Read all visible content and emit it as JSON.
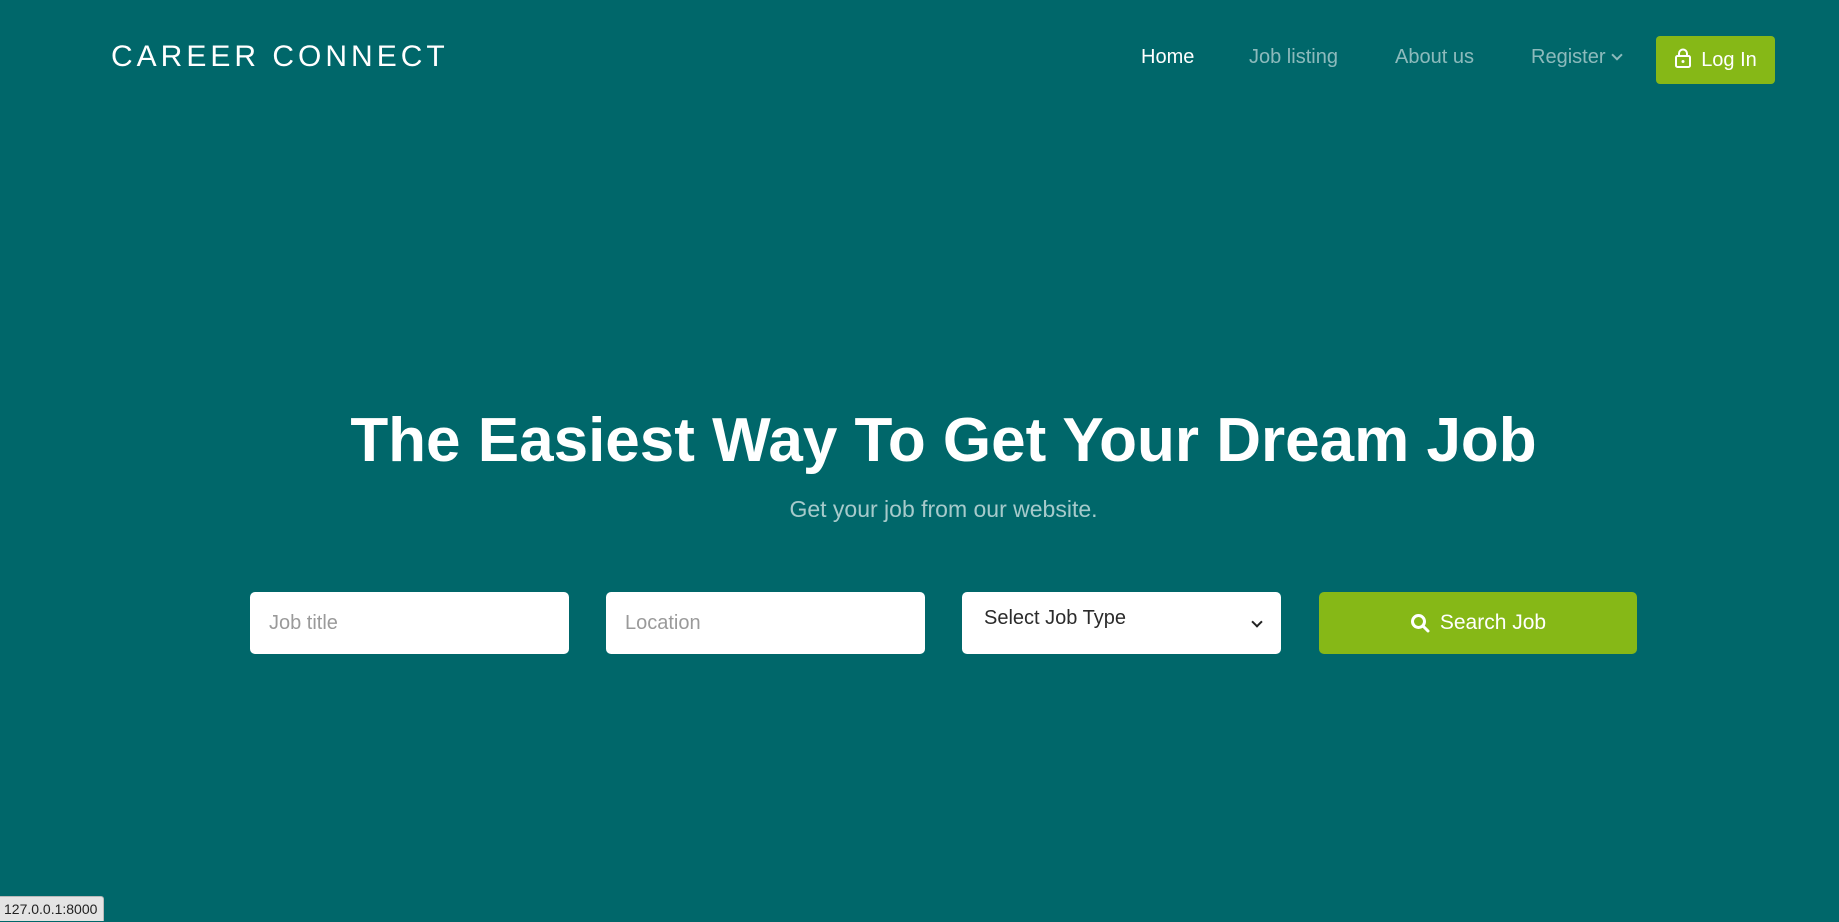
{
  "header": {
    "brand": "CAREER CONNECT",
    "nav": [
      {
        "label": "Home",
        "active": true
      },
      {
        "label": "Job listing",
        "active": false
      },
      {
        "label": "About us",
        "active": false
      },
      {
        "label": "Register",
        "active": false,
        "has_dropdown": true
      }
    ],
    "login_label": "Log In",
    "login_icon": "lock-icon"
  },
  "hero": {
    "title": "The Easiest Way To Get Your Dream Job",
    "subtitle": "Get your job from our website."
  },
  "search_form": {
    "job_title_placeholder": "Job title",
    "location_placeholder": "Location",
    "job_type_selected": "Select Job Type",
    "search_label": "Search Job",
    "search_icon": "search-icon"
  },
  "status_bar": {
    "url": "127.0.0.1:8000"
  },
  "colors": {
    "background": "#00676a",
    "accent": "#86b817",
    "text": "#ffffff"
  }
}
